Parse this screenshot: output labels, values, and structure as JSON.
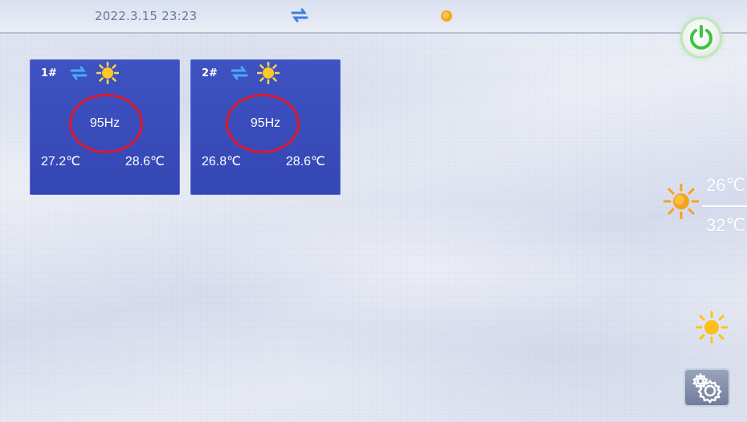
{
  "status_bar": {
    "datetime": "2022.3.15 23:23",
    "mode_icon": "heating-cooling-arrows-icon",
    "weather_icon": "sun-icon"
  },
  "units": [
    {
      "id": "1#",
      "frequency": "95Hz",
      "temp_a": "27.2℃",
      "temp_b": "28.6℃",
      "mode_icon": "arrows-icon",
      "weather_icon": "sun-icon"
    },
    {
      "id": "2#",
      "frequency": "95Hz",
      "temp_a": "26.8℃",
      "temp_b": "28.6℃",
      "mode_icon": "arrows-icon",
      "weather_icon": "sun-icon"
    }
  ],
  "outdoor": {
    "temp_high": "26℃",
    "temp_low": "32℃",
    "weather_icon": "sun-icon"
  },
  "controls": {
    "power_icon": "power-icon",
    "settings_icon": "gear-icon"
  },
  "colors": {
    "card_blue": "#3a4dbd",
    "annotation_red": "#e0182b",
    "power_green": "#3cc43c",
    "sun_orange": "#f7a21b"
  }
}
